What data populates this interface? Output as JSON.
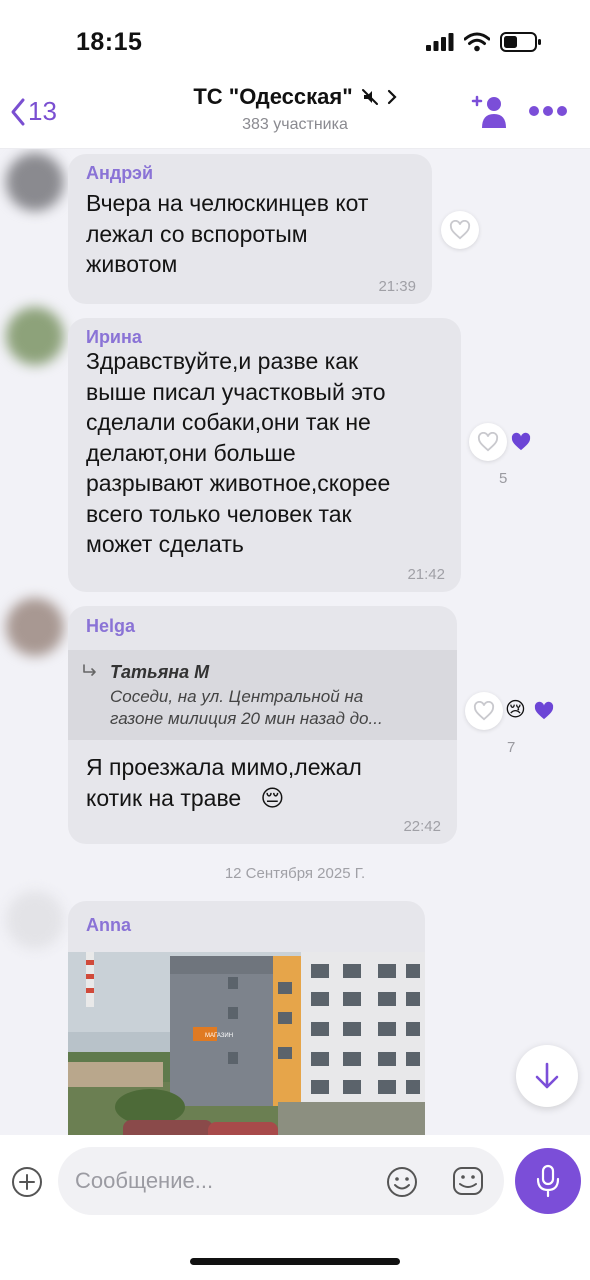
{
  "status_bar": {
    "time": "18:15"
  },
  "header": {
    "back_count": "13",
    "title": "ТС \"Одесская\"",
    "subtitle": "383 участника"
  },
  "messages": [
    {
      "sender": "Андрэй",
      "lines": [
        "Вчера на челюскинцев кот",
        "лежал со вспоротым",
        "животом"
      ],
      "time": "21:39"
    },
    {
      "sender": "Ирина",
      "lines": [
        "Здравствуйте,и разве как",
        "выше писал участковый это",
        "сделали собаки,они так не",
        "делают,они больше",
        "разрывают животное,скорее",
        "всего только человек так",
        "может сделать"
      ],
      "time": "21:42",
      "reaction_count": "5"
    },
    {
      "sender": "Helga",
      "quote_author": "Татьяна М",
      "quote_lines": [
        "Соседи, на ул. Центральной на",
        "газоне милиция 20 мин назад до..."
      ],
      "lines": [
        "Я проезжала  мимо,лежал",
        "котик на траве"
      ],
      "emoji": "😔",
      "time": "22:42",
      "reaction_count": "7",
      "reaction_emoji": "😢"
    }
  ],
  "date_separator": "12 Сентября 2025 Г.",
  "photo_message": {
    "sender": "Anna",
    "sign_text": "МАГАЗИН"
  },
  "input": {
    "placeholder": "Сообщение..."
  },
  "colors": {
    "accent": "#7b4ed8",
    "sender": "#8a73d6",
    "bubble": "#e6e6eb",
    "chat_bg": "#f2f2f7"
  },
  "icons": [
    "back-chevron-icon",
    "mute-icon",
    "chevron-right-icon",
    "add-member-icon",
    "more-icon",
    "heart-icon",
    "arrow-down-icon",
    "plus-icon",
    "emoji-icon",
    "sticker-icon",
    "mic-icon",
    "reply-icon"
  ]
}
